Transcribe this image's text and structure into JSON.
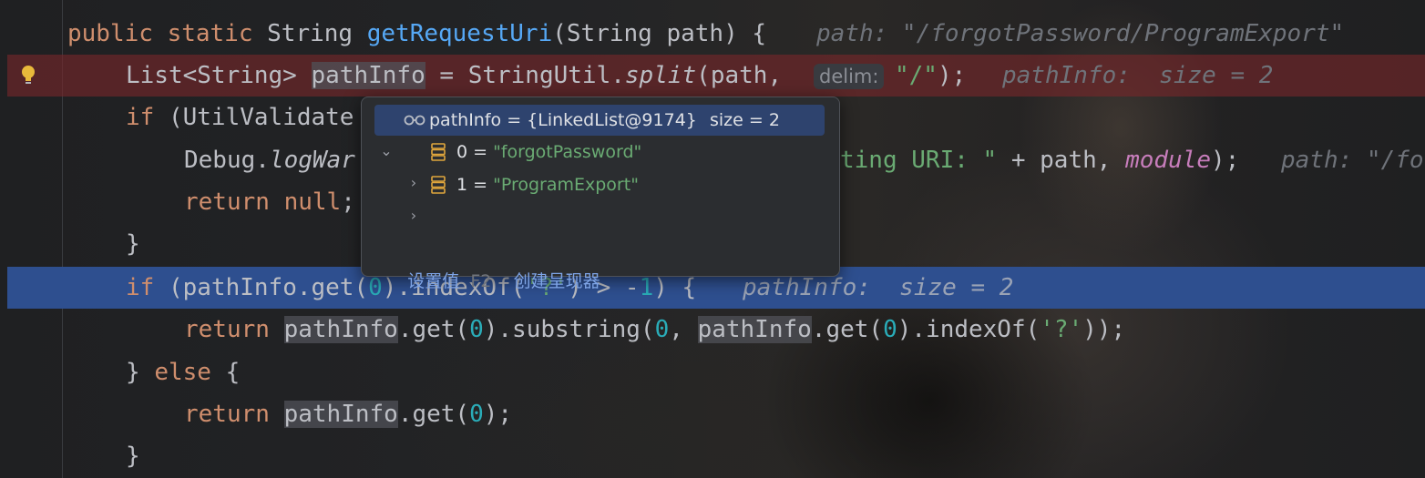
{
  "editor": {
    "lines": [
      {
        "id": "l0",
        "text": "public static String getRequestUri(String path) {"
      },
      {
        "id": "l1",
        "text": "List<String> pathInfo = StringUtil.split(path, \"/\");"
      },
      {
        "id": "l2",
        "text": "if (UtilValidate"
      },
      {
        "id": "l3",
        "text": "Debug.logWar"
      },
      {
        "id": "l3b",
        "text": "ting URI: \" + path, module);"
      },
      {
        "id": "l4",
        "text": "return null;"
      },
      {
        "id": "l5",
        "text": "}"
      },
      {
        "id": "l6",
        "text": "if (pathInfo.get(0).indexOf('?') > -1) {"
      },
      {
        "id": "l7",
        "text": "return pathInfo.get(0).substring(0, pathInfo.get(0).indexOf('?'));"
      },
      {
        "id": "l8",
        "text": "} else {"
      },
      {
        "id": "l9",
        "text": "return pathInfo.get(0);"
      },
      {
        "id": "l10",
        "text": "}"
      }
    ],
    "inline_hints": {
      "line0": "path: \"/forgotPassword/ProgramExport\"",
      "line1_param": "delim:",
      "line1": "pathInfo:  size = 2",
      "line3": "path: \"/fo",
      "line6": "pathInfo:  size = 2"
    },
    "gutter_icons": [
      "lightbulb-icon"
    ]
  },
  "popup": {
    "root": {
      "label": "pathInfo = {LinkedList@9174}",
      "size": "size = 2"
    },
    "children": [
      {
        "index": "0",
        "eq": " = ",
        "value": "\"forgotPassword\""
      },
      {
        "index": "1",
        "eq": " = ",
        "value": "\"ProgramExport\""
      }
    ],
    "footer": {
      "set_value": "设置值",
      "shortcut": "F2",
      "create_renderer": "创建呈现器"
    }
  },
  "colors": {
    "execution_line": "#2e4f8f",
    "error_line": "#78262a",
    "keyword": "#cf8e6d",
    "method": "#56a8f5",
    "string": "#6aab73",
    "number": "#2aacb8"
  }
}
